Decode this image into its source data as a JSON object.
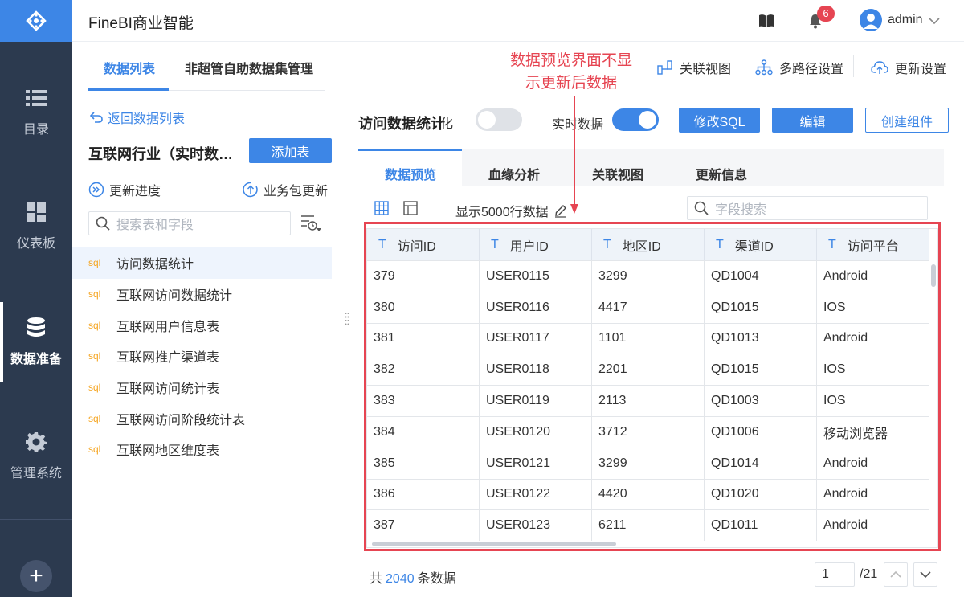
{
  "nav": {
    "items": [
      {
        "label": "目录",
        "icon": "list-icon"
      },
      {
        "label": "仪表板",
        "icon": "dashboard-icon"
      },
      {
        "label": "数据准备",
        "icon": "database-icon"
      },
      {
        "label": "管理系统",
        "icon": "gear-icon"
      }
    ],
    "add_label": "+"
  },
  "header": {
    "title": "FineBI商业智能",
    "notification_count": "6",
    "username": "admin"
  },
  "left_panel": {
    "tabs": [
      "数据列表",
      "非超管自助数据集管理"
    ],
    "back_label": "返回数据列表",
    "package_title": "互联网行业（实时数据）",
    "add_table_label": "添加表",
    "update_progress_label": "更新进度",
    "package_update_label": "业务包更新",
    "search_placeholder": "搜索表和字段",
    "tables": [
      {
        "tag": "sql",
        "name": "访问数据统计"
      },
      {
        "tag": "sql",
        "name": "互联网访问数据统计"
      },
      {
        "tag": "sql",
        "name": "互联网用户信息表"
      },
      {
        "tag": "sql",
        "name": "互联网推广渠道表"
      },
      {
        "tag": "sql",
        "name": "互联网访问统计表"
      },
      {
        "tag": "sql",
        "name": "互联网访问阶段统计表"
      },
      {
        "tag": "sql",
        "name": "互联网地区维度表"
      }
    ]
  },
  "toolbar": {
    "relation_view": "关联视图",
    "multipath": "多路径设置",
    "update_settings": "更新设置"
  },
  "annotation": {
    "line1": "数据预览界面不显",
    "line2": "示更新后数据"
  },
  "dataset": {
    "title": "访问数据统计",
    "hidden_label": "化",
    "realtime_label": "实时数据",
    "edit_sql": "修改SQL",
    "edit": "编辑",
    "create_component": "创建组件"
  },
  "main_tabs": [
    "数据预览",
    "血缘分析",
    "关联视图",
    "更新信息"
  ],
  "preview": {
    "rows_label": "显示5000行数据",
    "field_search_placeholder": "字段搜索"
  },
  "table": {
    "type_marker": "T",
    "columns": [
      "访问ID",
      "用户ID",
      "地区ID",
      "渠道ID",
      "访问平台"
    ],
    "rows": [
      [
        "379",
        "USER0115",
        "3299",
        "QD1004",
        "Android"
      ],
      [
        "380",
        "USER0116",
        "4417",
        "QD1015",
        "IOS"
      ],
      [
        "381",
        "USER0117",
        "1101",
        "QD1013",
        "Android"
      ],
      [
        "382",
        "USER0118",
        "2201",
        "QD1015",
        "IOS"
      ],
      [
        "383",
        "USER0119",
        "2113",
        "QD1003",
        "IOS"
      ],
      [
        "384",
        "USER0120",
        "3712",
        "QD1006",
        "移动浏览器"
      ],
      [
        "385",
        "USER0121",
        "3299",
        "QD1014",
        "Android"
      ],
      [
        "386",
        "USER0122",
        "4420",
        "QD1020",
        "Android"
      ],
      [
        "387",
        "USER0123",
        "6211",
        "QD1011",
        "Android"
      ]
    ]
  },
  "footer": {
    "total_prefix": "共",
    "total_count": "2040",
    "total_suffix": "条数据",
    "current_page": "1",
    "page_total": "/21"
  },
  "colors": {
    "accent": "#3d86e6",
    "nav_bg": "#2c3a4f",
    "highlight": "#e64552"
  }
}
